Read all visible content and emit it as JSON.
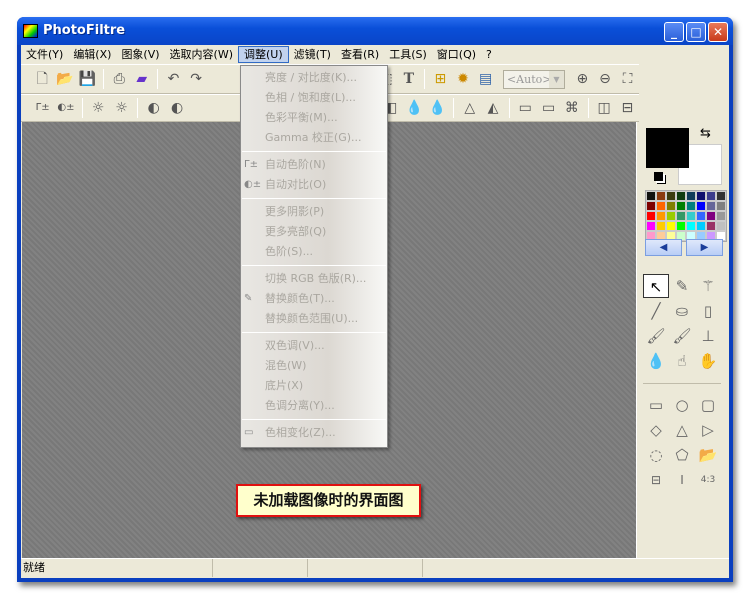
{
  "window": {
    "title": "PhotoFiltre",
    "minimize": "_",
    "maximize": "□",
    "close": "✕"
  },
  "menu": [
    "文件(Y)",
    "编辑(X)",
    "图象(V)",
    "选取内容(W)",
    "调整(U)",
    "滤镜(T)",
    "查看(R)",
    "工具(S)",
    "窗口(Q)",
    "?"
  ],
  "active_menu_index": 4,
  "toolbar": {
    "zoom_value": "<Auto>"
  },
  "adjust_menu": {
    "groups": [
      [
        {
          "label": "亮度 / 对比度(K)..."
        },
        {
          "label": "色相 / 饱和度(L)..."
        },
        {
          "label": "色彩平衡(M)..."
        },
        {
          "label": "Gamma 校正(G)..."
        }
      ],
      [
        {
          "label": "自动色阶(N)",
          "icon": "auto-levels-icon"
        },
        {
          "label": "自动对比(O)",
          "icon": "auto-contrast-icon"
        }
      ],
      [
        {
          "label": "更多阴影(P)"
        },
        {
          "label": "更多亮部(Q)"
        },
        {
          "label": "色阶(S)..."
        }
      ],
      [
        {
          "label": "切换 RGB 色版(R)..."
        },
        {
          "label": "替换颜色(T)...",
          "icon": "eyedropper-icon"
        },
        {
          "label": "替换颜色范围(U)..."
        }
      ],
      [
        {
          "label": "双色调(V)..."
        },
        {
          "label": "混色(W)"
        },
        {
          "label": "底片(X)"
        },
        {
          "label": "色调分离(Y)..."
        }
      ],
      [
        {
          "label": "色相变化(Z)...",
          "icon": "hue-variation-icon"
        }
      ]
    ]
  },
  "colors": {
    "foreground": "#000000",
    "background": "#ffffff",
    "palette": [
      "#111111",
      "#8b3a10",
      "#3c3c10",
      "#103c10",
      "#103c5a",
      "#10106e",
      "#3c3c8c",
      "#333333",
      "#800000",
      "#ff6600",
      "#808000",
      "#008000",
      "#008080",
      "#0000ff",
      "#666699",
      "#808080",
      "#ff0000",
      "#ff9900",
      "#99cc00",
      "#339966",
      "#33cccc",
      "#3366ff",
      "#800080",
      "#999999",
      "#ff00ff",
      "#ffcc00",
      "#ffff00",
      "#00ff00",
      "#00ffff",
      "#00ccff",
      "#993366",
      "#c0c0c0",
      "#ff99cc",
      "#ffcc99",
      "#ffff99",
      "#ccffcc",
      "#ccffff",
      "#99ccff",
      "#cc99ff",
      "#ffffff"
    ]
  },
  "annotation": "未加载图像时的界面图",
  "status": {
    "text": "就绪"
  }
}
